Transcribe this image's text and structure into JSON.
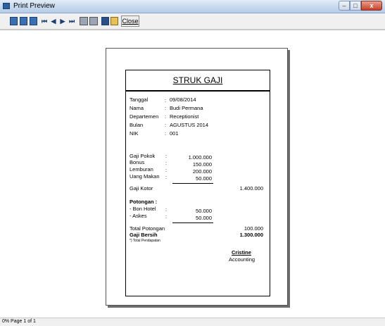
{
  "window": {
    "title": "Print Preview",
    "min": "–",
    "max": "□",
    "close": "x"
  },
  "toolbar": {
    "close_label": "Close",
    "nav": [
      "⏮",
      "◀",
      "▶",
      "⏭"
    ]
  },
  "receipt": {
    "title": "STRUK GAJI",
    "info": [
      {
        "label": "Tanggal",
        "colon": ":",
        "value": "09/08/2014"
      },
      {
        "label": "Nama",
        "colon": ":",
        "value": "Budi Permana"
      },
      {
        "label": "Departemen",
        "colon": ":",
        "value": "Receptionist"
      },
      {
        "label": "Bulan",
        "colon": ":",
        "value": "AGUSTUS 2014"
      },
      {
        "label": "NIK",
        "colon": ":",
        "value": "001"
      }
    ],
    "earnings": [
      {
        "label": "Gaji Pokok",
        "colon": ":",
        "value": "1.000.000"
      },
      {
        "label": "Bonus",
        "colon": ":",
        "value": "150.000"
      },
      {
        "label": "Lemburan",
        "colon": ":",
        "value": "200.000"
      },
      {
        "label": "Uang Makan",
        "colon": ":",
        "value": "50.000"
      }
    ],
    "gross_label": "Gaji Kotor",
    "gross_value": "1.400.000",
    "deductions_heading": "Potongan :",
    "deductions": [
      {
        "label": "- Bon Hotel",
        "colon": ":",
        "value": "50.000"
      },
      {
        "label": "- Askes",
        "colon": ":",
        "value": "50.000"
      }
    ],
    "total_deductions_label": "Total Potongan",
    "total_deductions_value": "100.000",
    "net_label": "Gaji Bersih",
    "net_value": "1.300.000",
    "net_note": "*) Total Pendapatan",
    "signer_name": "Cristine",
    "signer_role": "Accounting"
  },
  "status": {
    "text": "0% Page 1 of 1"
  }
}
